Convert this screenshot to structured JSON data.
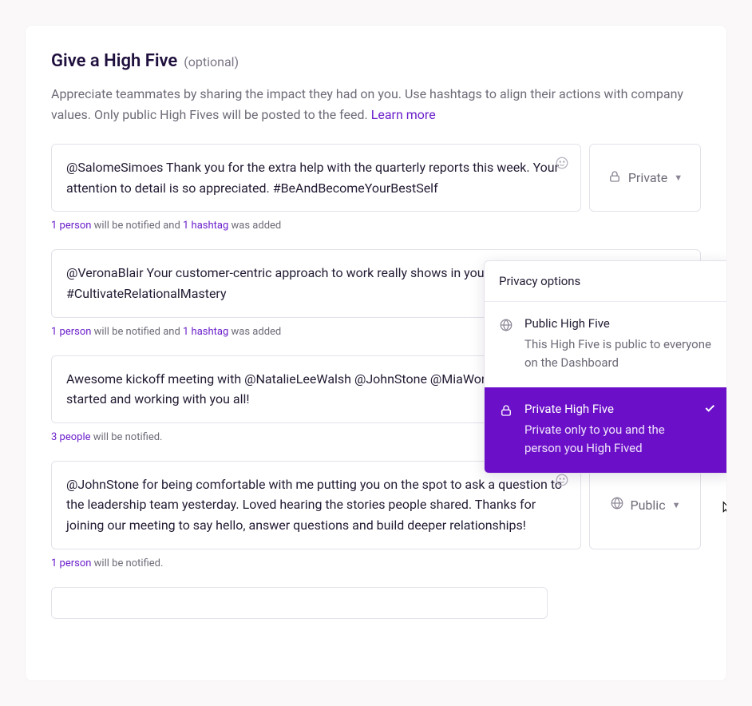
{
  "header": {
    "title": "Give a High Five",
    "optional": "(optional)",
    "description": "Appreciate teammates by sharing the impact they had on you. Use hashtags to align their actions with company values. Only public High Fives will be posted to the feed.",
    "learn_more": "Learn more"
  },
  "entries": [
    {
      "text": "@SalomeSimoes Thank you for the extra help with the quarterly reports this week. Your attention to detail is so appreciated. #BeAndBecomeYourBestSelf",
      "privacy_label": "Private",
      "privacy": "private",
      "meta_people": "1 person",
      "meta_mid": " will be notified and ",
      "meta_tags": "1 hashtag",
      "meta_end": " was added"
    },
    {
      "text": "@VeronaBlair Your customer-centric approach to work really shows in your relationships. Keep it up! #CultivateRelationalMastery",
      "meta_people": "1 person",
      "meta_mid": " will be notified and ",
      "meta_tags": "1 hashtag",
      "meta_end": " was added"
    },
    {
      "text": "Awesome kickoff meeting with @NatalieLeeWalsh @JohnStone @MiaWong. I am excited to get this project started and working with you all!",
      "meta_people": "3 people",
      "meta_end": " will be notified."
    },
    {
      "text": "@JohnStone for being comfortable with me putting you on the spot to ask a question to the leadership team yesterday. Loved hearing the stories people shared. Thanks for joining our meeting to say hello, answer questions and build deeper relationships!",
      "privacy_label": "Public",
      "privacy": "public",
      "meta_people": "1 person",
      "meta_end": " will be notified."
    }
  ],
  "dropdown": {
    "header": "Privacy options",
    "public_title": "Public High Five",
    "public_desc": "This High Five is public to everyone on the Dashboard",
    "private_title": "Private High Five",
    "private_desc": "Private only to you and the person you High Fived"
  }
}
